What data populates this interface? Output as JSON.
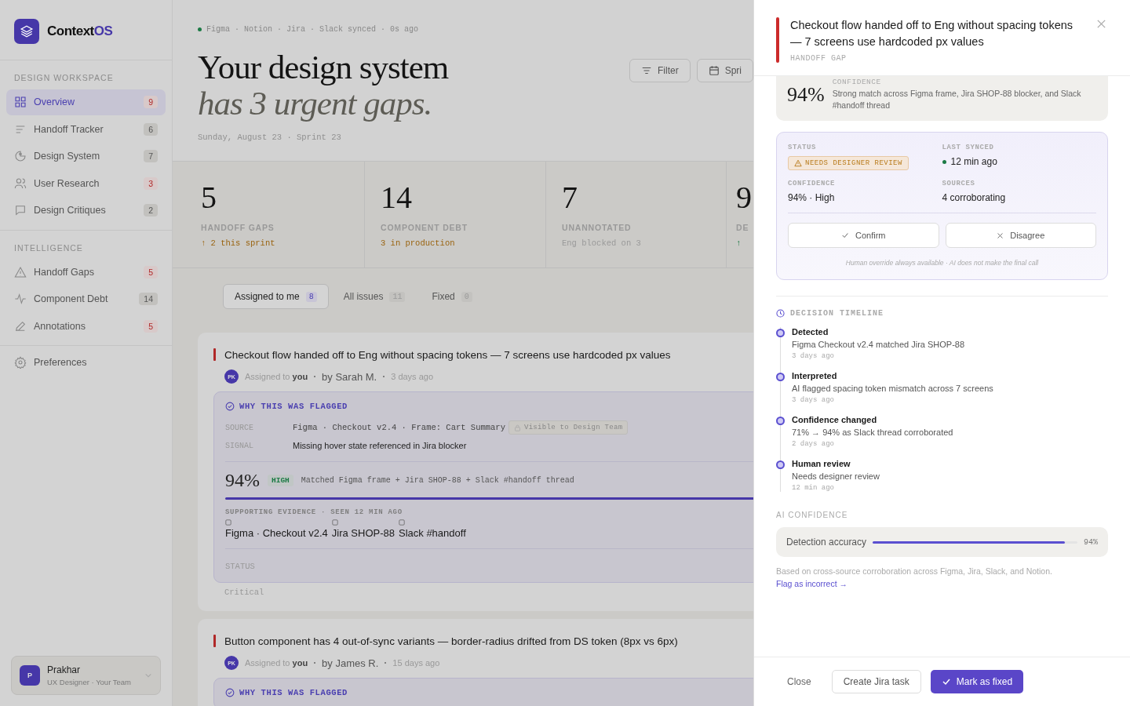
{
  "sidebar": {
    "brand": {
      "name": "Context",
      "accent": "OS"
    },
    "sections": [
      {
        "heading": "DESIGN WORKSPACE",
        "items": [
          {
            "label": "Overview",
            "count": "9",
            "urgent": true,
            "selected": true
          },
          {
            "label": "Handoff Tracker",
            "count": "6",
            "urgent": false,
            "selected": false
          },
          {
            "label": "Design System",
            "count": "7",
            "urgent": false,
            "selected": false
          },
          {
            "label": "User Research",
            "count": "3",
            "urgent": true,
            "selected": false
          },
          {
            "label": "Design Critiques",
            "count": "2",
            "urgent": false,
            "selected": false
          }
        ]
      },
      {
        "heading": "INTELLIGENCE",
        "items": [
          {
            "label": "Handoff Gaps",
            "count": "5",
            "urgent": true,
            "selected": false
          },
          {
            "label": "Component Debt",
            "count": "14",
            "urgent": false,
            "selected": false
          },
          {
            "label": "Annotations",
            "count": "5",
            "urgent": true,
            "selected": false
          }
        ]
      }
    ],
    "preferences": "Preferences",
    "user": {
      "initial": "P",
      "name": "Prakhar",
      "role": "UX Designer · Your Team"
    }
  },
  "header": {
    "sync": {
      "synced": true,
      "text": "Figma · Notion · Jira · Slack synced · 0s ago"
    },
    "title": "Your design system",
    "subtitle": "has 3 urgent gaps.",
    "date": "Sunday, August 23 · Sprint 23",
    "buttons": [
      "Filter",
      "Spri"
    ]
  },
  "stats": [
    {
      "value": "5",
      "label": "HANDOFF GAPS",
      "note": "↑ 2 this sprint",
      "kind": "warn"
    },
    {
      "value": "14",
      "label": "COMPONENT DEBT",
      "note": "3 in production",
      "kind": "warn"
    },
    {
      "value": "7",
      "label": "UNANNOTATED",
      "note": "Eng blocked on 3",
      "kind": "muted"
    },
    {
      "value": "9",
      "label": "DE",
      "note": "↑",
      "kind": "good"
    }
  ],
  "tabs": [
    {
      "label": "Assigned to me",
      "count": "8",
      "selected": true
    },
    {
      "label": "All issues",
      "count": "11",
      "selected": false
    },
    {
      "label": "Fixed",
      "count": "0",
      "selected": false
    }
  ],
  "issues": [
    {
      "title": "Checkout flow handed off to Eng without spacing tokens — 7 screens use hardcoded px values",
      "avatar": "PK",
      "assigned": "Assigned to **you**",
      "author": "by Sarah M.",
      "time": "3 days ago",
      "flag": {
        "heading": "WHY THIS WAS FLAGGED",
        "source_label": "SOURCE",
        "source": "Figma · Checkout v2.4 · Frame: Cart Summary",
        "visibility": "Visible to Design Team",
        "signal_label": "SIGNAL",
        "signal": "Missing hover state referenced in Jira blocker",
        "confidence": "94%",
        "confidence_tag": "HIGH",
        "match": "Matched Figma frame + Jira SHOP-88 + Slack #handoff thread",
        "evidence_heading": "SUPPORTING EVIDENCE · SEEN 12 MIN AGO",
        "evidence": [
          "Figma · Checkout v2.4",
          "Jira SHOP-88",
          "Slack #handoff"
        ],
        "status_label": "STATUS"
      },
      "severity": "Critical"
    },
    {
      "title": "Button component has 4 out-of-sync variants — border-radius drifted from DS token (8px vs 6px)",
      "avatar": "PK",
      "assigned": "Assigned to **you**",
      "author": "by James R.",
      "time": "15 days ago",
      "flag": {
        "heading": "WHY THIS WAS FLAGGED"
      }
    }
  ],
  "drawer": {
    "title": "Checkout flow handed off to Eng without spacing tokens — 7 screens use hardcoded px values",
    "category": "HANDOFF GAP",
    "confidence": {
      "value": "94%",
      "label": "CONFIDENCE",
      "text": "Strong match across Figma frame, Jira SHOP-88 blocker, and Slack #handoff thread"
    },
    "status_card": {
      "fields": [
        {
          "label": "STATUS",
          "value": "NEEDS DESIGNER REVIEW",
          "kind": "badge"
        },
        {
          "label": "LAST SYNCED",
          "value": "12 min ago",
          "kind": "live"
        },
        {
          "label": "CONFIDENCE",
          "value": "94% · High",
          "kind": "text"
        },
        {
          "label": "SOURCES",
          "value": "4 corroborating",
          "kind": "text"
        }
      ],
      "buttons": [
        "Confirm",
        "Disagree"
      ],
      "note": "Human override always available · AI does not make the final call"
    },
    "timeline": {
      "heading": "DECISION TIMELINE",
      "events": [
        {
          "title": "Detected",
          "text": "Figma Checkout v2.4 matched Jira SHOP-88",
          "time": "3 days ago"
        },
        {
          "title": "Interpreted",
          "text": "AI flagged spacing token mismatch across 7 screens",
          "time": "3 days ago"
        },
        {
          "title": "Confidence changed",
          "text": "71% → 94% as Slack thread corroborated",
          "time": "2 days ago"
        },
        {
          "title": "Human review",
          "text": "Needs designer review",
          "time": "12 min ago"
        }
      ]
    },
    "ai": {
      "heading": "AI CONFIDENCE",
      "label": "Detection accuracy",
      "level": 0.94,
      "reading": "94%",
      "note": "Based on cross-source corroboration across Figma, Jira, Slack, and Notion.",
      "link": "Flag as incorrect →"
    },
    "footer": [
      "Close",
      "Create Jira task",
      "Mark as fixed"
    ]
  }
}
